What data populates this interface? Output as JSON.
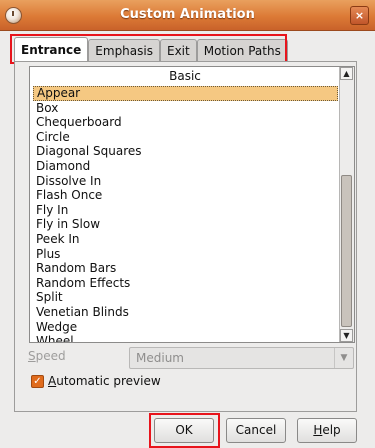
{
  "window": {
    "title": "Custom Animation",
    "close_glyph": "×",
    "menu_icon": "window-menu-icon"
  },
  "tabs": [
    {
      "label": "Entrance",
      "active": true
    },
    {
      "label": "Emphasis",
      "active": false
    },
    {
      "label": "Exit",
      "active": false
    },
    {
      "label": "Motion Paths",
      "active": false
    }
  ],
  "effects_list": {
    "header": "Basic",
    "selected": "Appear",
    "items": [
      "Appear",
      "Box",
      "Chequerboard",
      "Circle",
      "Diagonal Squares",
      "Diamond",
      "Dissolve In",
      "Flash Once",
      "Fly In",
      "Fly in Slow",
      "Peek In",
      "Plus",
      "Random Bars",
      "Random Effects",
      "Split",
      "Venetian Blinds",
      "Wedge",
      "Wheel"
    ]
  },
  "speed": {
    "label_mnemonic": "S",
    "label_rest": "peed",
    "value": "Medium",
    "enabled": false
  },
  "automatic_preview": {
    "mnemonic": "A",
    "label_rest": "utomatic preview",
    "checked": true
  },
  "buttons": {
    "ok": "OK",
    "cancel": "Cancel",
    "help_mnemonic": "H",
    "help_rest": "elp"
  },
  "colors": {
    "titlebar": "#DC7A36",
    "highlight_box": "#E8141C",
    "selection": "#F5C882",
    "checkbox": "#E06B1C"
  }
}
